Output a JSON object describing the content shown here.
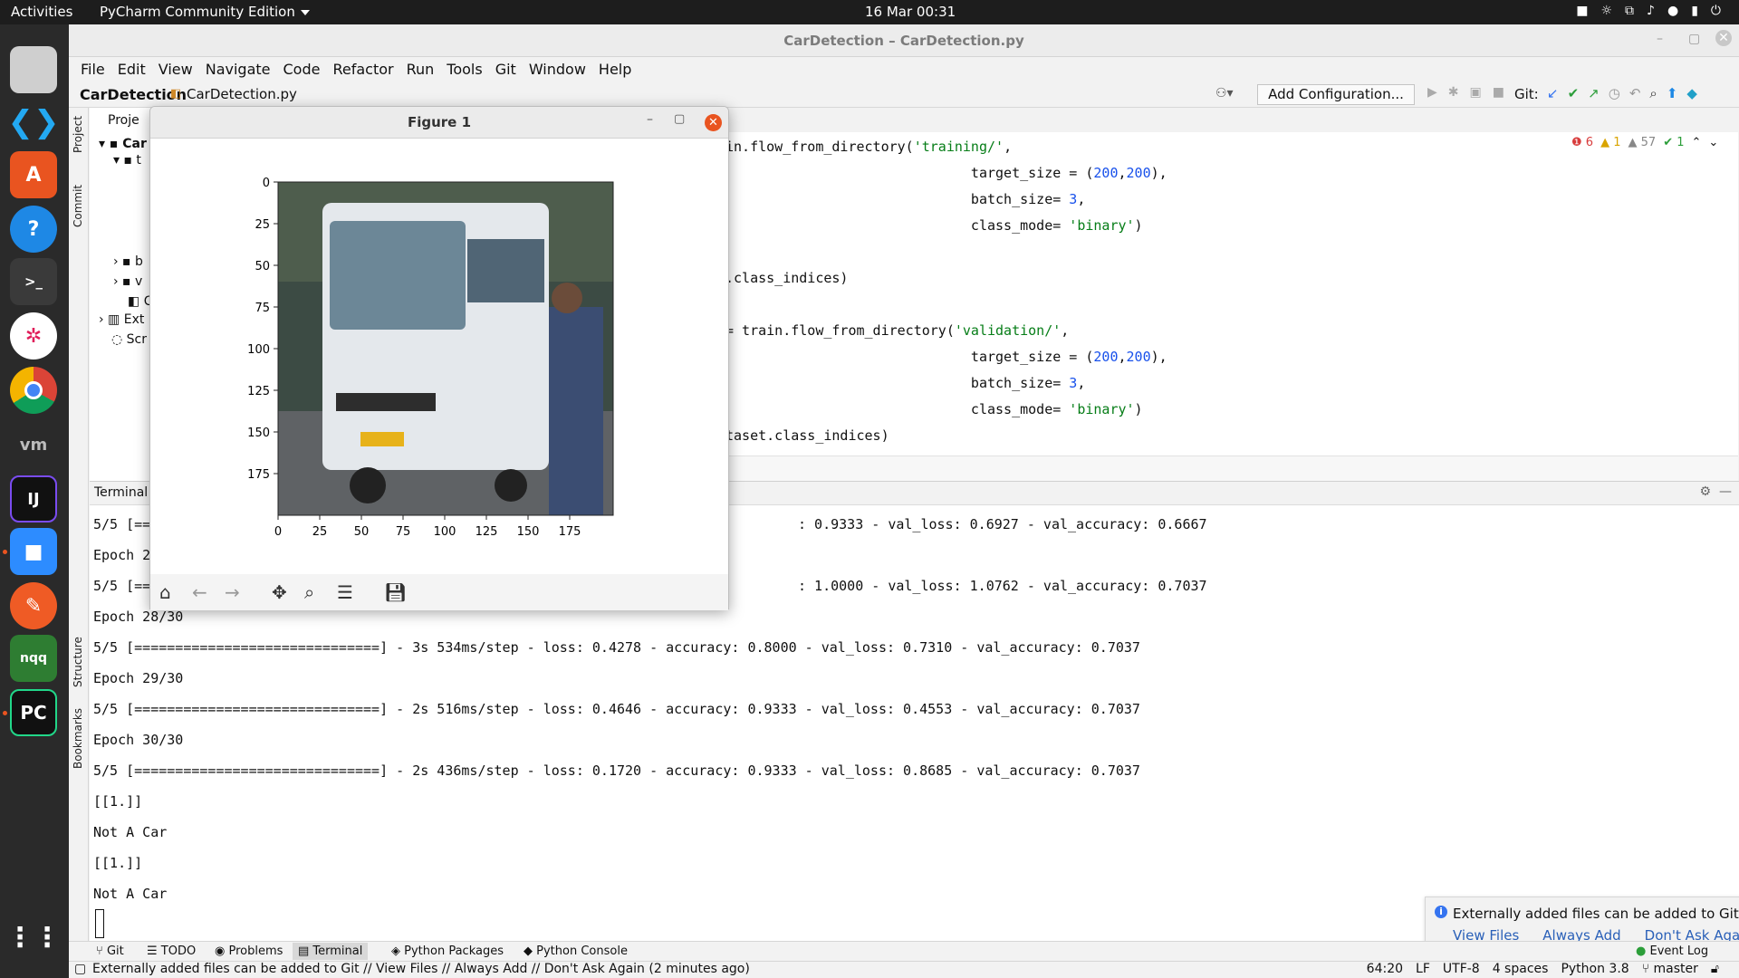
{
  "topbar": {
    "activities": "Activities",
    "app_name": "PyCharm Community Edition",
    "clock": "16 Mar  00:31"
  },
  "dock": {
    "apps": [
      "files-icon",
      "vscode-icon",
      "software-icon",
      "help-icon",
      "terminal-icon",
      "slack-icon",
      "chrome-icon",
      "vm-icon",
      "intellij-icon",
      "zoom-icon",
      "postman-icon",
      "nqq-icon",
      "pycharm-icon"
    ],
    "show_apps": "show-applications-icon"
  },
  "window": {
    "title": "CarDetection – CarDetection.py"
  },
  "menu": [
    "File",
    "Edit",
    "View",
    "Navigate",
    "Code",
    "Refactor",
    "Run",
    "Tools",
    "Git",
    "Window",
    "Help"
  ],
  "nav": {
    "project": "CarDetection",
    "file": "CarDetection.py",
    "add_config": "Add Configuration...",
    "git_label": "Git:"
  },
  "side_tabs": {
    "project": "Project",
    "commit": "Commit",
    "structure": "Structure",
    "bookmarks": "Bookmarks"
  },
  "project_tree": {
    "header": "Proje",
    "rows": [
      "Car",
      "t",
      "b",
      "v",
      "C",
      "Ext",
      "Scr"
    ]
  },
  "editor": {
    "lines": [
      [
        "in.flow_from_directory(",
        "'training/'",
        ","
      ],
      [
        "                              target_size = (",
        "200",
        ",",
        "200",
        "),"
      ],
      [
        "                              batch_size= ",
        "3",
        ","
      ],
      [
        "                              class_mode= ",
        "'binary'",
        ")"
      ],
      [
        ""
      ],
      [
        ".class_indices)"
      ],
      [
        ""
      ],
      [
        "= train.flow_from_directory(",
        "'validation/'",
        ","
      ],
      [
        "                              target_size = (",
        "200",
        ",",
        "200",
        "),"
      ],
      [
        "                              batch_size= ",
        "3",
        ","
      ],
      [
        "                              class_mode= ",
        "'binary'",
        ")"
      ],
      [
        "taset.class_indices)"
      ]
    ],
    "inspections": {
      "errors": "6",
      "warnings": "1",
      "weak": "57",
      "ok": "1"
    }
  },
  "terminal": {
    "title": "Terminal",
    "lines": [
      "5/5 [==",
      "Epoch 2",
      "5/5 [==",
      "Epoch 28/30",
      "5/5 [==============================] - 3s 534ms/step - loss: 0.4278 - accuracy: 0.8000 - val_loss: 0.7310 - val_accuracy: 0.7037",
      "Epoch 29/30",
      "5/5 [==============================] - 2s 516ms/step - loss: 0.4646 - accuracy: 0.9333 - val_loss: 0.4553 - val_accuracy: 0.7037",
      "Epoch 30/30",
      "5/5 [==============================] - 2s 436ms/step - loss: 0.1720 - accuracy: 0.9333 - val_loss: 0.8685 - val_accuracy: 0.7037",
      "[[1.]]",
      "Not A Car",
      "[[1.]]",
      "Not A Car"
    ],
    "hidden_tails": [
      ": 0.9333 - val_loss: 0.6927 - val_accuracy: 0.6667",
      ": 1.0000 - val_loss: 1.0762 - val_accuracy: 0.7037"
    ]
  },
  "notification": {
    "message": "Externally added files can be added to Git",
    "actions": [
      "View Files",
      "Always Add",
      "Don't Ask Again"
    ]
  },
  "tool_windows": [
    "Git",
    "TODO",
    "Problems",
    "Terminal",
    "Python Packages",
    "Python Console",
    "Event Log"
  ],
  "status": {
    "message": "Externally added files can be added to Git // View Files // Always Add // Don't Ask Again (2 minutes ago)",
    "position": "64:20",
    "line_sep": "LF",
    "encoding": "UTF-8",
    "indent": "4 spaces",
    "interpreter": "Python 3.8",
    "branch": "master"
  },
  "figure": {
    "title": "Figure 1",
    "y_ticks": [
      "0",
      "25",
      "50",
      "75",
      "100",
      "125",
      "150",
      "175"
    ],
    "x_ticks": [
      "0",
      "25",
      "50",
      "75",
      "100",
      "125",
      "150",
      "175"
    ],
    "toolbar": [
      "home-icon",
      "back-icon",
      "forward-icon",
      "pan-icon",
      "zoom-icon",
      "configure-icon",
      "save-icon"
    ]
  },
  "colors": {
    "accent": "#e95420",
    "link": "#2a60b8",
    "string": "#067d17",
    "number": "#1750eb",
    "keyword": "#871094"
  }
}
